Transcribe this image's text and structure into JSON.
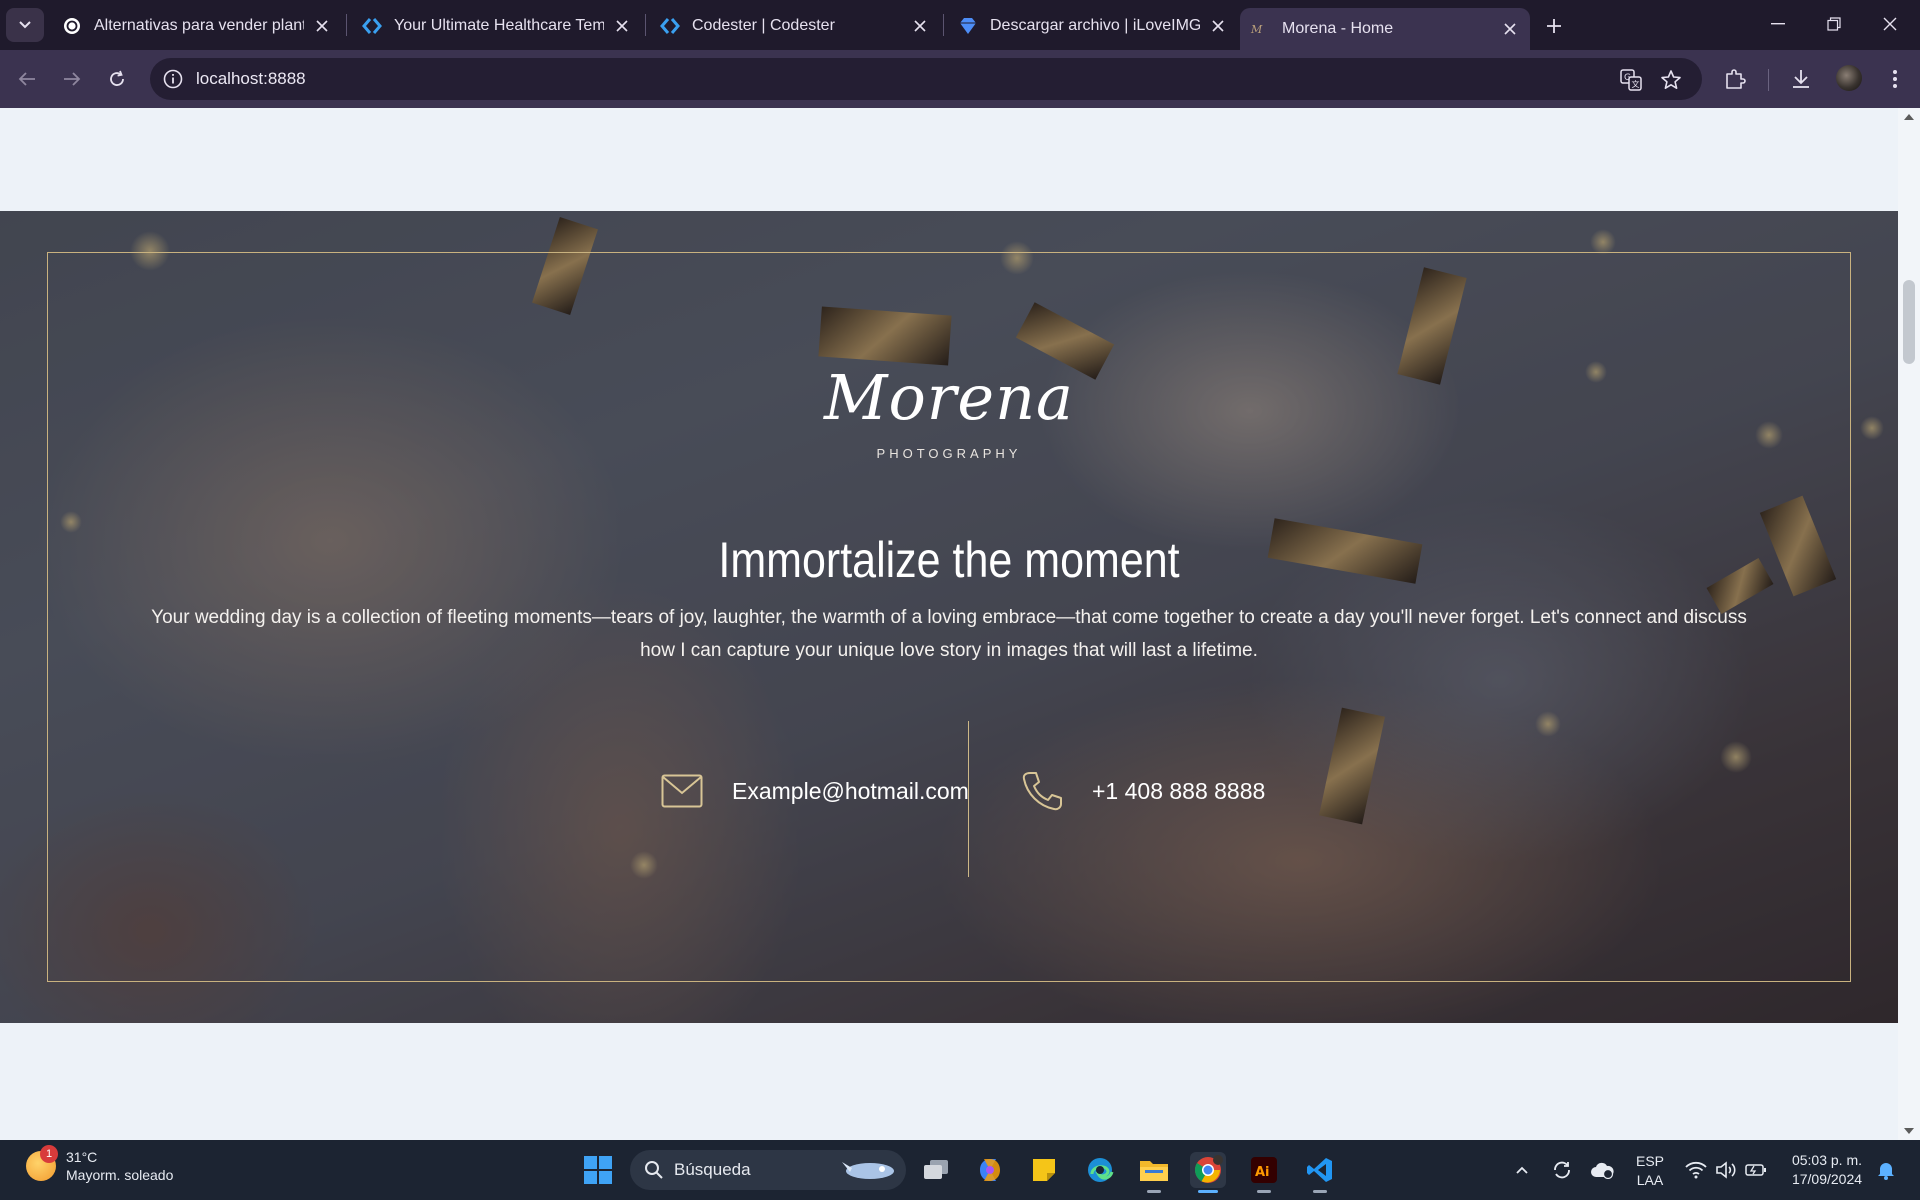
{
  "browser": {
    "tabs": [
      {
        "title": "Alternativas para vender plantil",
        "favicon": "openai-icon",
        "active": false
      },
      {
        "title": "Your Ultimate Healthcare Templ",
        "favicon": "codester-icon",
        "active": false
      },
      {
        "title": "Codester | Codester",
        "favicon": "codester-icon",
        "active": false
      },
      {
        "title": "Descargar archivo | iLoveIMG",
        "favicon": "iloveimg-icon",
        "active": false
      },
      {
        "title": "Morena - Home",
        "favicon": "morena-icon",
        "active": true
      }
    ],
    "url": "localhost:8888"
  },
  "page": {
    "logo": "Morena",
    "logo_subtitle": "PHOTOGRAPHY",
    "headline": "Immortalize the moment",
    "description": "Your wedding day is a collection of fleeting moments—tears of joy, laughter, the warmth of a loving embrace—that come together to create a day you'll never forget. Let's connect and discuss how I can capture your unique love story in images that will last a lifetime.",
    "email": "Example@hotmail.com",
    "phone": "+1 408 888 8888",
    "accent_color": "#c9b27f"
  },
  "taskbar": {
    "weather_temp": "31°C",
    "weather_desc": "Mayorm. soleado",
    "weather_badge": "1",
    "search_label": "Búsqueda",
    "lang_top": "ESP",
    "lang_bottom": "LAA",
    "time": "05:03 p. m.",
    "date": "17/09/2024"
  }
}
